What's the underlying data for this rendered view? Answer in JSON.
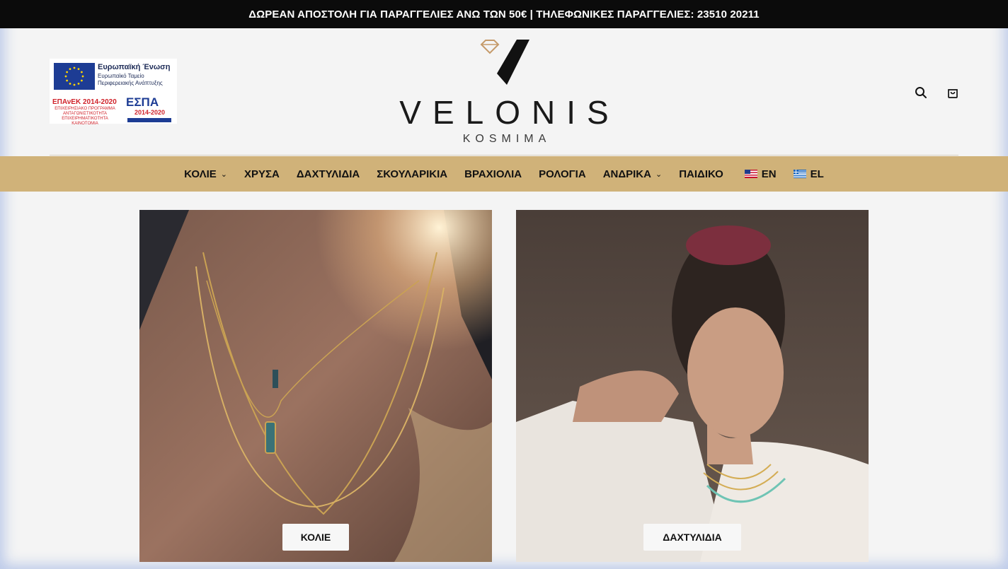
{
  "topbar": {
    "announcement": "ΔΩΡΕΑΝ ΑΠΟΣΤΟΛΗ ΓΙΑ ΠΑΡΑΓΓΕΛΙΕΣ ΑΝΩ ΤΩΝ 50€ | ΤΗΛΕΦΩΝΙΚΕΣ ΠΑΡΑΓΓΕΛΙΕΣ: 23510 20211"
  },
  "espa_banner": {
    "eu_title": "Ευρωπαϊκή Ένωση",
    "eu_subtitle": "Ευρωπαϊκό Ταμείο Περιφερειακής Ανάπτυξης",
    "epanek": "ΕΠΑνΕΚ 2014-2020",
    "epanek_subtitle": "ΕΠΙΧΕΙΡΗΣΙΑΚΟ ΠΡΟΓΡΑΜΜΑ ΑΝΤΑΓΩΝΙΣΤΙΚΟΤΗΤΑ ΕΠΙΧΕΙΡΗΜΑΤΙΚΟΤΗΤΑ ΚΑΙΝΟΤΟΜΙΑ",
    "espa_logo": "ΕΣΠΑ",
    "espa_years": "2014-2020"
  },
  "logo": {
    "name": "VELONIS",
    "subtitle": "KOSMIMA"
  },
  "header_icons": [
    "search-icon",
    "cart-icon"
  ],
  "nav": {
    "items": [
      {
        "label": "ΚΟΛΙΕ",
        "has_dropdown": true
      },
      {
        "label": "ΧΡΥΣΑ",
        "has_dropdown": false
      },
      {
        "label": "ΔΑΧΤΥΛΙΔΙΑ",
        "has_dropdown": false
      },
      {
        "label": "ΣΚΟΥΛΑΡΙΚΙΑ",
        "has_dropdown": false
      },
      {
        "label": "ΒΡΑΧΙΟΛΙΑ",
        "has_dropdown": false
      },
      {
        "label": "ΡΟΛΟΓΙΑ",
        "has_dropdown": false
      },
      {
        "label": "ΑΝΔΡΙΚΑ",
        "has_dropdown": true
      },
      {
        "label": "ΠΑΙΔΙΚΟ",
        "has_dropdown": false
      }
    ],
    "languages": [
      {
        "code": "EN",
        "flag": "us-flag"
      },
      {
        "code": "EL",
        "flag": "greece-flag"
      }
    ]
  },
  "categories": [
    {
      "label": "ΚΟΛΙΕ"
    },
    {
      "label": "ΔΑΧΤΥΛΙΔΙΑ"
    }
  ],
  "colors": {
    "topbar": "#0b0b0b",
    "nav_background": "#d0b279",
    "page_background": "#f4f4f4"
  }
}
